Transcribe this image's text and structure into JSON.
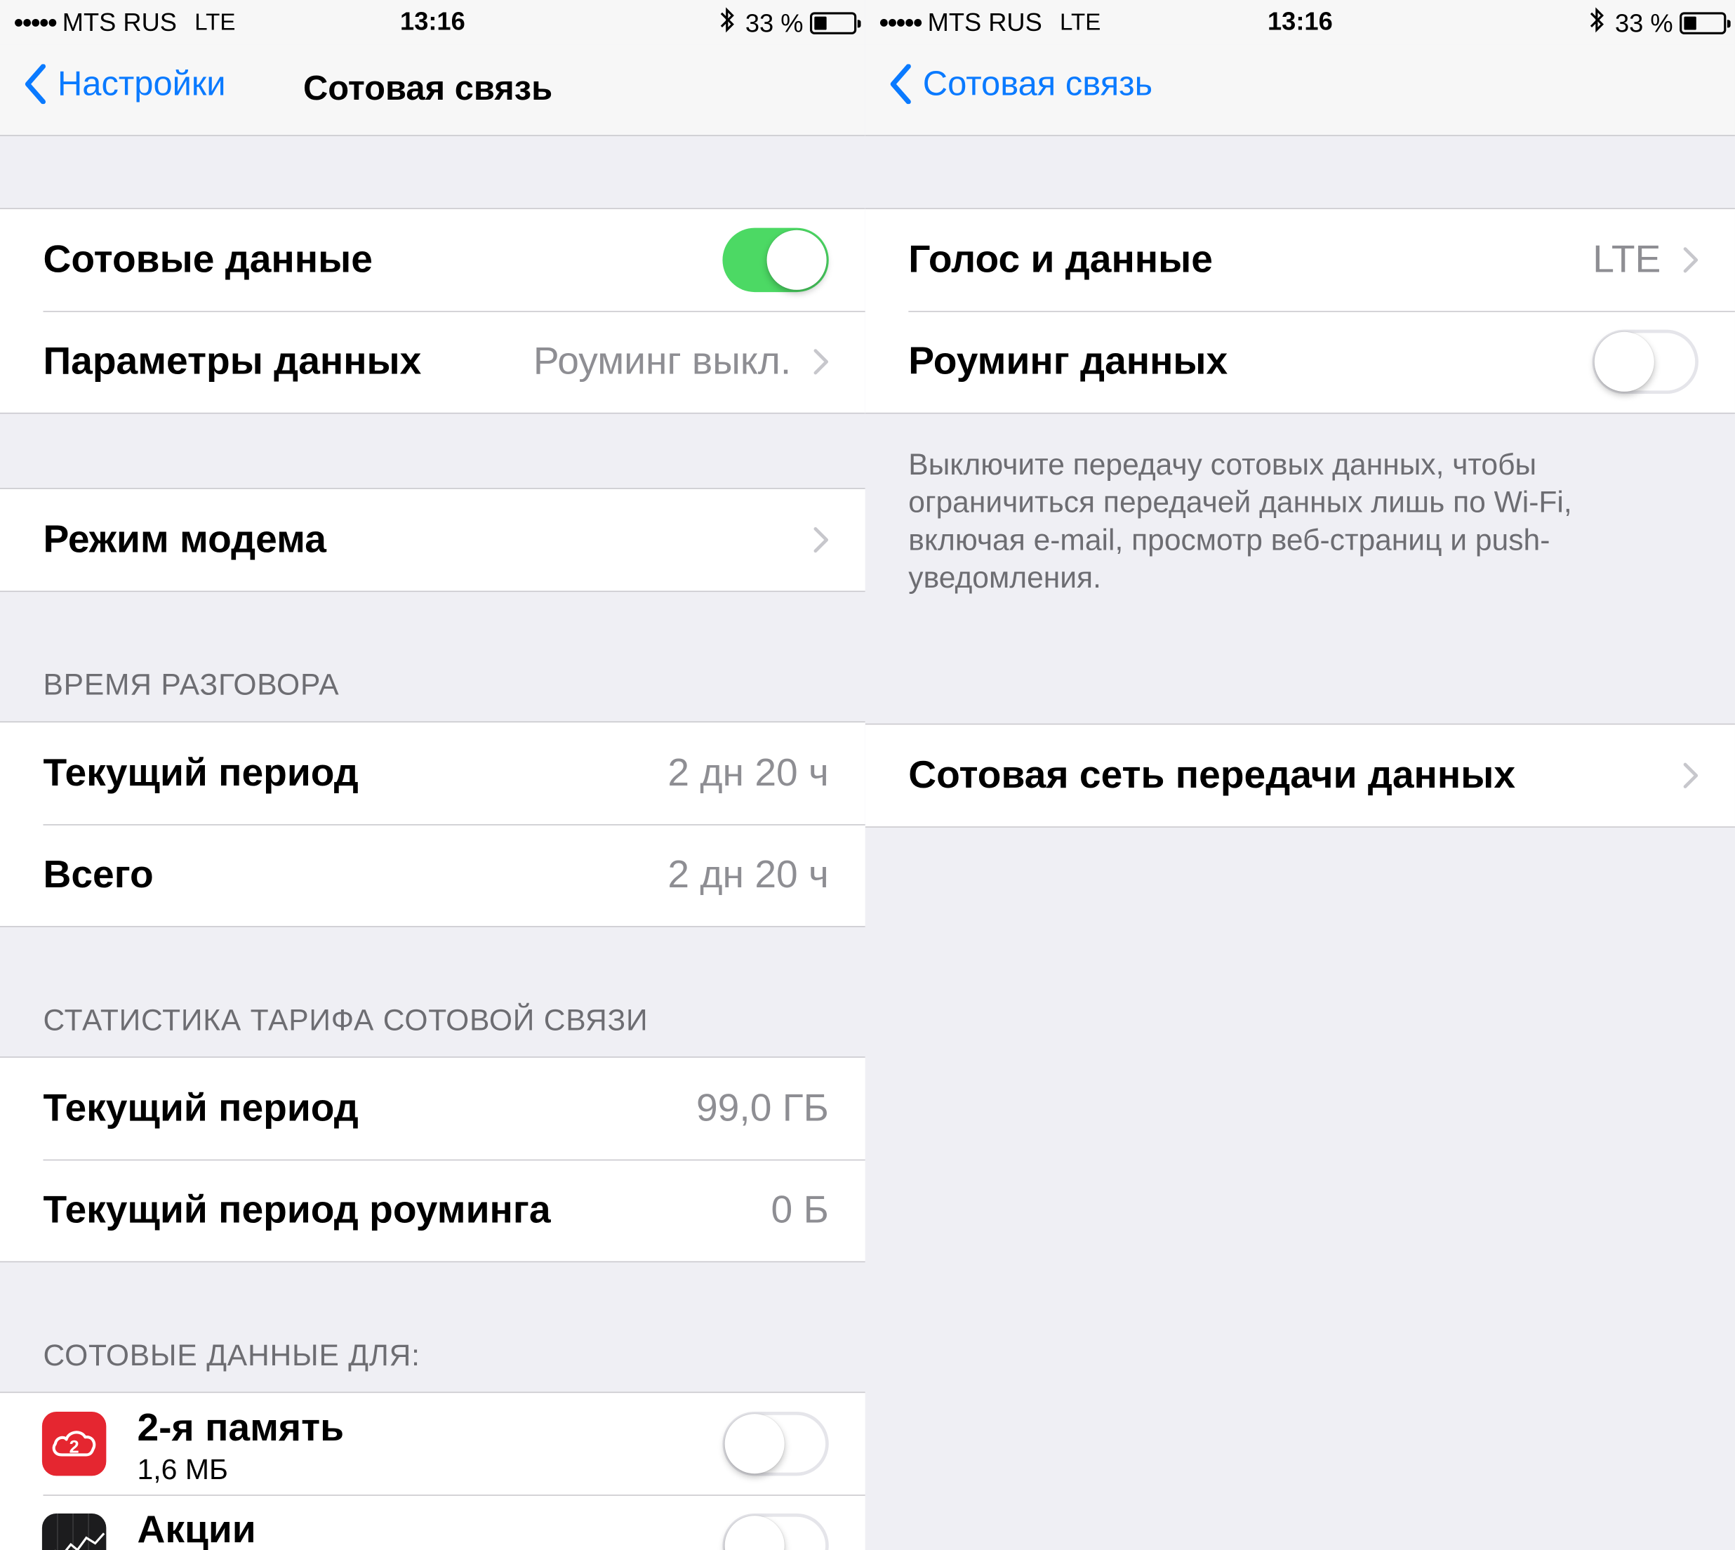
{
  "status_bar": {
    "signal_dots": "●●●●●",
    "carrier": "MTS RUS",
    "network": "LTE",
    "time": "13:16",
    "battery_text": "33 %",
    "battery_level": 0.33
  },
  "left": {
    "nav": {
      "back_label": "Настройки",
      "title": "Сотовая связь"
    },
    "group1": {
      "cellular_data_label": "Сотовые данные",
      "cellular_data_on": true,
      "data_options_label": "Параметры данных",
      "data_options_value": "Роуминг выкл."
    },
    "group2": {
      "hotspot_label": "Режим модема"
    },
    "talk_time": {
      "header": "ВРЕМЯ РАЗГОВОРА",
      "rows": [
        {
          "label": "Текущий период",
          "value": "2 дн 20 ч"
        },
        {
          "label": "Всего",
          "value": "2 дн 20 ч"
        }
      ]
    },
    "usage": {
      "header": "СТАТИСТИКА ТАРИФА СОТОВОЙ СВЯЗИ",
      "rows": [
        {
          "label": "Текущий период",
          "value": "99,0 ГБ"
        },
        {
          "label": "Текущий период роуминга",
          "value": "0 Б"
        }
      ]
    },
    "apps": {
      "header": "СОТОВЫЕ ДАННЫЕ ДЛЯ:",
      "items": [
        {
          "name": "2-я память",
          "usage": "1,6 МБ",
          "icon": "cloud-2-icon",
          "on": false
        },
        {
          "name": "Акции",
          "usage": "",
          "icon": "stocks-icon",
          "on": false
        }
      ]
    }
  },
  "right": {
    "nav": {
      "back_label": "Сотовая связь"
    },
    "group1": {
      "voice_data_label": "Голос и данные",
      "voice_data_value": "LTE",
      "roaming_label": "Роуминг данных",
      "roaming_on": false
    },
    "footer": "Выключите передачу сотовых данных, чтобы ограничиться передачей данных лишь по Wi-Fi, включая e-mail, просмотр веб-страниц и push-уведомления.",
    "group2": {
      "cellular_network_label": "Сотовая сеть передачи данных"
    }
  },
  "colors": {
    "accent": "#0a7aff",
    "switch_on": "#4cd964",
    "background": "#efeff4",
    "secondary_text": "#8e8e93",
    "app_red": "#e52630"
  }
}
